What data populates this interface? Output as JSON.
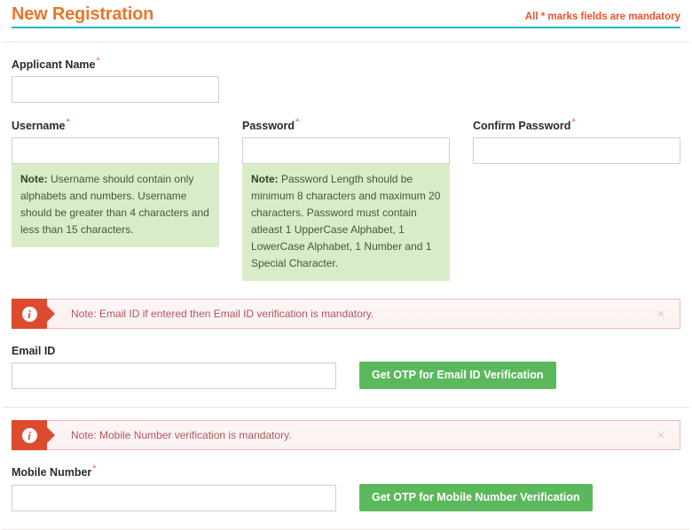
{
  "header": {
    "title": "New Registration",
    "mandatory_note": "All * marks fields are mandatory",
    "accent_title_color": "#e8762c",
    "accent_rule_color": "#27b3c4",
    "mandatory_note_color": "#e8522c"
  },
  "form": {
    "applicant_name": {
      "label": "Applicant Name",
      "required_marker": "*",
      "value": "",
      "placeholder": ""
    },
    "username": {
      "label": "Username",
      "required_marker": "*",
      "value": "",
      "placeholder": "",
      "note_prefix": "Note:",
      "note_text": " Username should contain only alphabets and numbers. Username should be greater than 4 characters and less than 15 characters."
    },
    "password": {
      "label": "Password",
      "required_marker": "*",
      "value": "",
      "placeholder": "",
      "note_prefix": "Note:",
      "note_text": " Password Length should be minimum 8 characters and maximum 20 characters. Password must contain atleast 1 UpperCase Alphabet, 1 LowerCase Alphabet, 1 Number and 1 Special Character."
    },
    "confirm_password": {
      "label": "Confirm Password",
      "required_marker": "*",
      "value": "",
      "placeholder": ""
    },
    "email": {
      "alert_text": "Note: Email ID if entered then Email ID verification is mandatory.",
      "alert_icon": "info-icon",
      "close_icon": "×",
      "label": "Email ID",
      "required_marker": "",
      "value": "",
      "placeholder": "",
      "otp_button": "Get OTP for Email ID Verification"
    },
    "mobile": {
      "alert_text": "Note: Mobile Number verification is mandatory.",
      "alert_icon": "info-icon",
      "close_icon": "×",
      "label": "Mobile Number",
      "required_marker": "*",
      "value": "",
      "placeholder": "",
      "otp_button": "Get OTP for Mobile Number Verification"
    }
  },
  "colors": {
    "note_box_bg": "#d8ecc8",
    "alert_icon_bg": "#dd4b2f",
    "alert_border": "#edb6b6",
    "otp_button_bg": "#5cb85c",
    "divider": "#ece6dc"
  }
}
